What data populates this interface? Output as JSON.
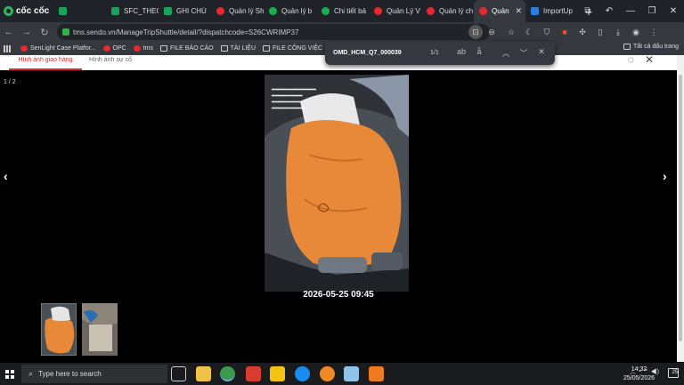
{
  "browser": {
    "brand": "cốc cốc",
    "tabs": [
      {
        "title": "",
        "fav": "green"
      },
      {
        "title": "SFC_THEO",
        "fav": "green"
      },
      {
        "title": "GHI CHÚ",
        "fav": "green"
      },
      {
        "title": "Quản lý Sh",
        "fav": "red"
      },
      {
        "title": "Quản lý b",
        "fav": "grn2"
      },
      {
        "title": "Chi tiết bả",
        "fav": "grn2"
      },
      {
        "title": "Quản Lý V",
        "fav": "red"
      },
      {
        "title": "Quản lý ch",
        "fav": "red"
      },
      {
        "title": "Quản",
        "fav": "red",
        "active": true
      },
      {
        "title": "ImportUp",
        "fav": "blue"
      }
    ],
    "url": "tms.sendo.vn/ManageTripShuttle/detail/?dispatchcode=S26CWRIMP37",
    "bookmarks": [
      {
        "label": "",
        "icon": "apps"
      },
      {
        "label": "SenLight Case Platfor...",
        "icon": "sendo"
      },
      {
        "label": "OPC",
        "icon": "sendo"
      },
      {
        "label": "tms",
        "icon": "sendo"
      },
      {
        "label": "FILE BÁO CÁO",
        "icon": "folder"
      },
      {
        "label": "TÀI LIỆU",
        "icon": "folder"
      },
      {
        "label": "FILE CÔNG VIỆC",
        "icon": "folder"
      }
    ],
    "all_bookmarks": "Tất cả dấu trang"
  },
  "findbar": {
    "query": "OMD_HCM_Q7_000039",
    "count": "1/1"
  },
  "viewer": {
    "tab_primary": "Hình ảnh giao hàng",
    "tab_secondary": "Hình ảnh sự cố",
    "counter": "1 / 2",
    "timestamp": "2026-05-25 09:45"
  },
  "taskbar": {
    "search_placeholder": "Type here to search",
    "time": "14:32",
    "date": "25/05/2026",
    "notifications": "25"
  },
  "colors": {
    "accent": "#e0252d",
    "bag": "#e8893a"
  }
}
